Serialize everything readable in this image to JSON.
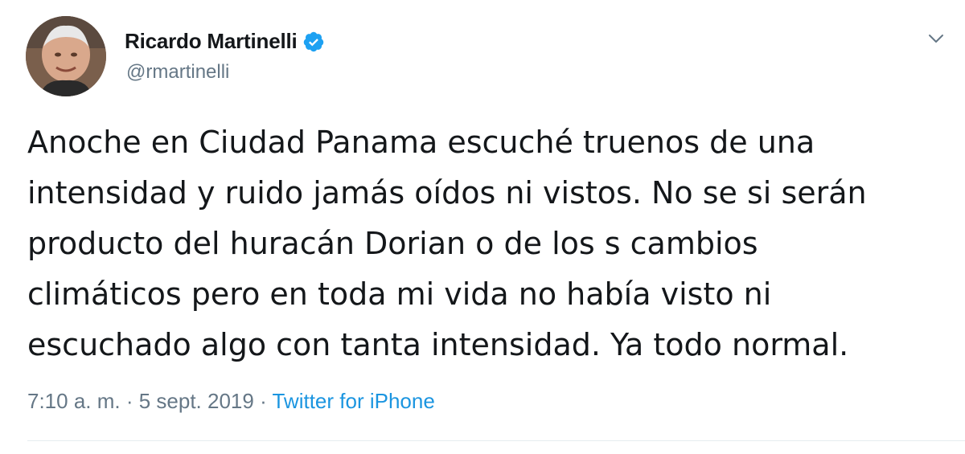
{
  "user": {
    "display_name": "Ricardo Martinelli",
    "handle": "@rmartinelli",
    "verified_icon": "verified-badge-icon",
    "verified_color": "#1da1f2"
  },
  "tweet": {
    "lines": [
      "Anoche en Ciudad Panama escuché truenos de una",
      "intensidad y ruido jamás oídos ni vistos. No se si serán",
      "producto del huracán Dorian o de los s cambios",
      "climáticos pero en toda mi vida no había visto ni",
      "escuchado algo con tanta intensidad. Ya todo normal."
    ],
    "timestamp": "7:10 a. m. · 5 sept. 2019",
    "separator": " · ",
    "source": "Twitter for iPhone"
  },
  "menu_icon": "chevron-down-icon",
  "colors": {
    "text": "#14171a",
    "secondary": "#657786",
    "link": "#1b95e0"
  }
}
